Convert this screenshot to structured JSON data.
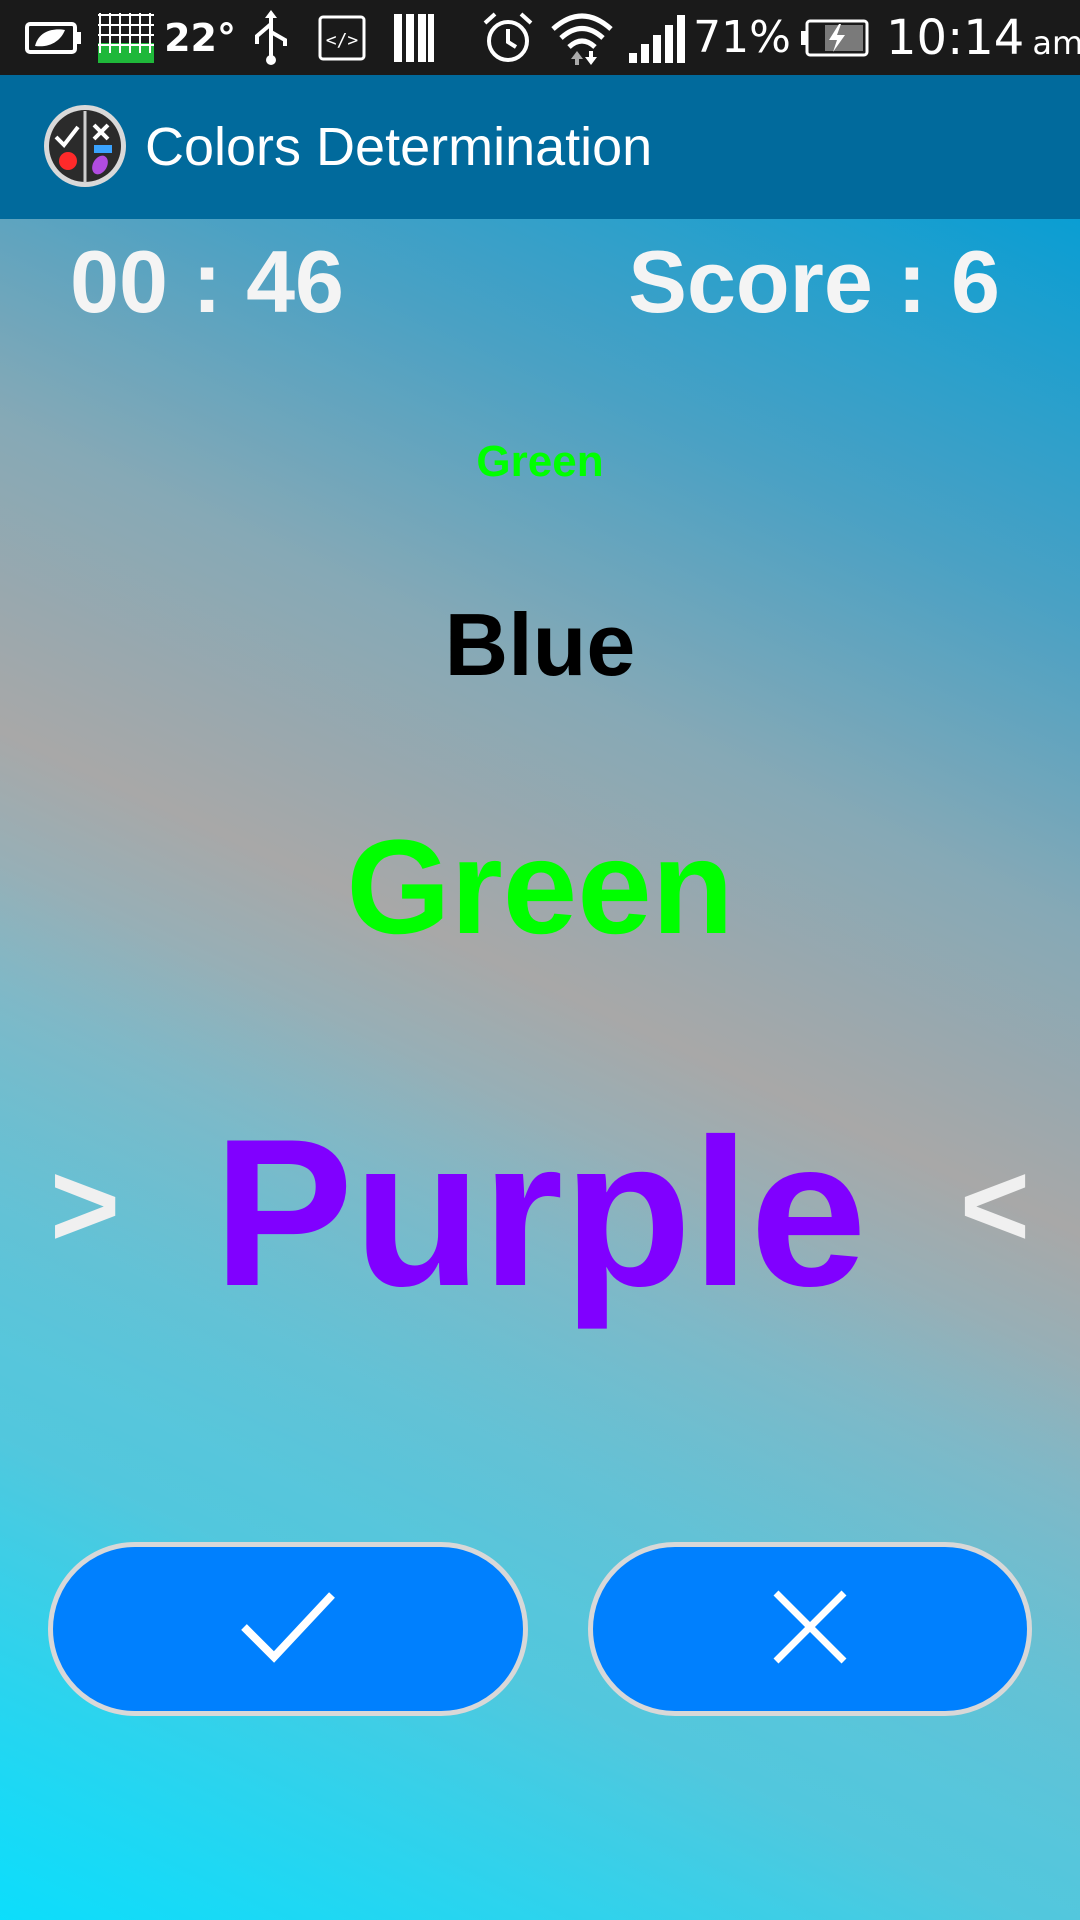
{
  "status_bar": {
    "temperature": "22°",
    "battery_percent": "71%",
    "time": "10:14",
    "time_suffix": "am",
    "icons": [
      "battery-saver-icon",
      "grid-widget-icon",
      "usb-icon",
      "developer-code-icon",
      "library-icon",
      "alarm-icon",
      "wifi-icon",
      "signal-icon",
      "battery-charging-icon"
    ]
  },
  "action_bar": {
    "title": "Colors Determination",
    "logo_icon": "app-logo-icon"
  },
  "game": {
    "timer": "00 : 46",
    "score": "Score : 6",
    "words": [
      {
        "text": "Green",
        "color": "#00ff00"
      },
      {
        "text": "Blue",
        "color": "#000000"
      },
      {
        "text": "Green",
        "color": "#00ff00"
      },
      {
        "text": "Purple",
        "color": "#8000ff"
      }
    ],
    "left_marker": ">",
    "right_marker": "<"
  },
  "buttons": {
    "yes_icon": "checkmark-icon",
    "no_icon": "close-icon",
    "button_color": "#0080fe"
  }
}
